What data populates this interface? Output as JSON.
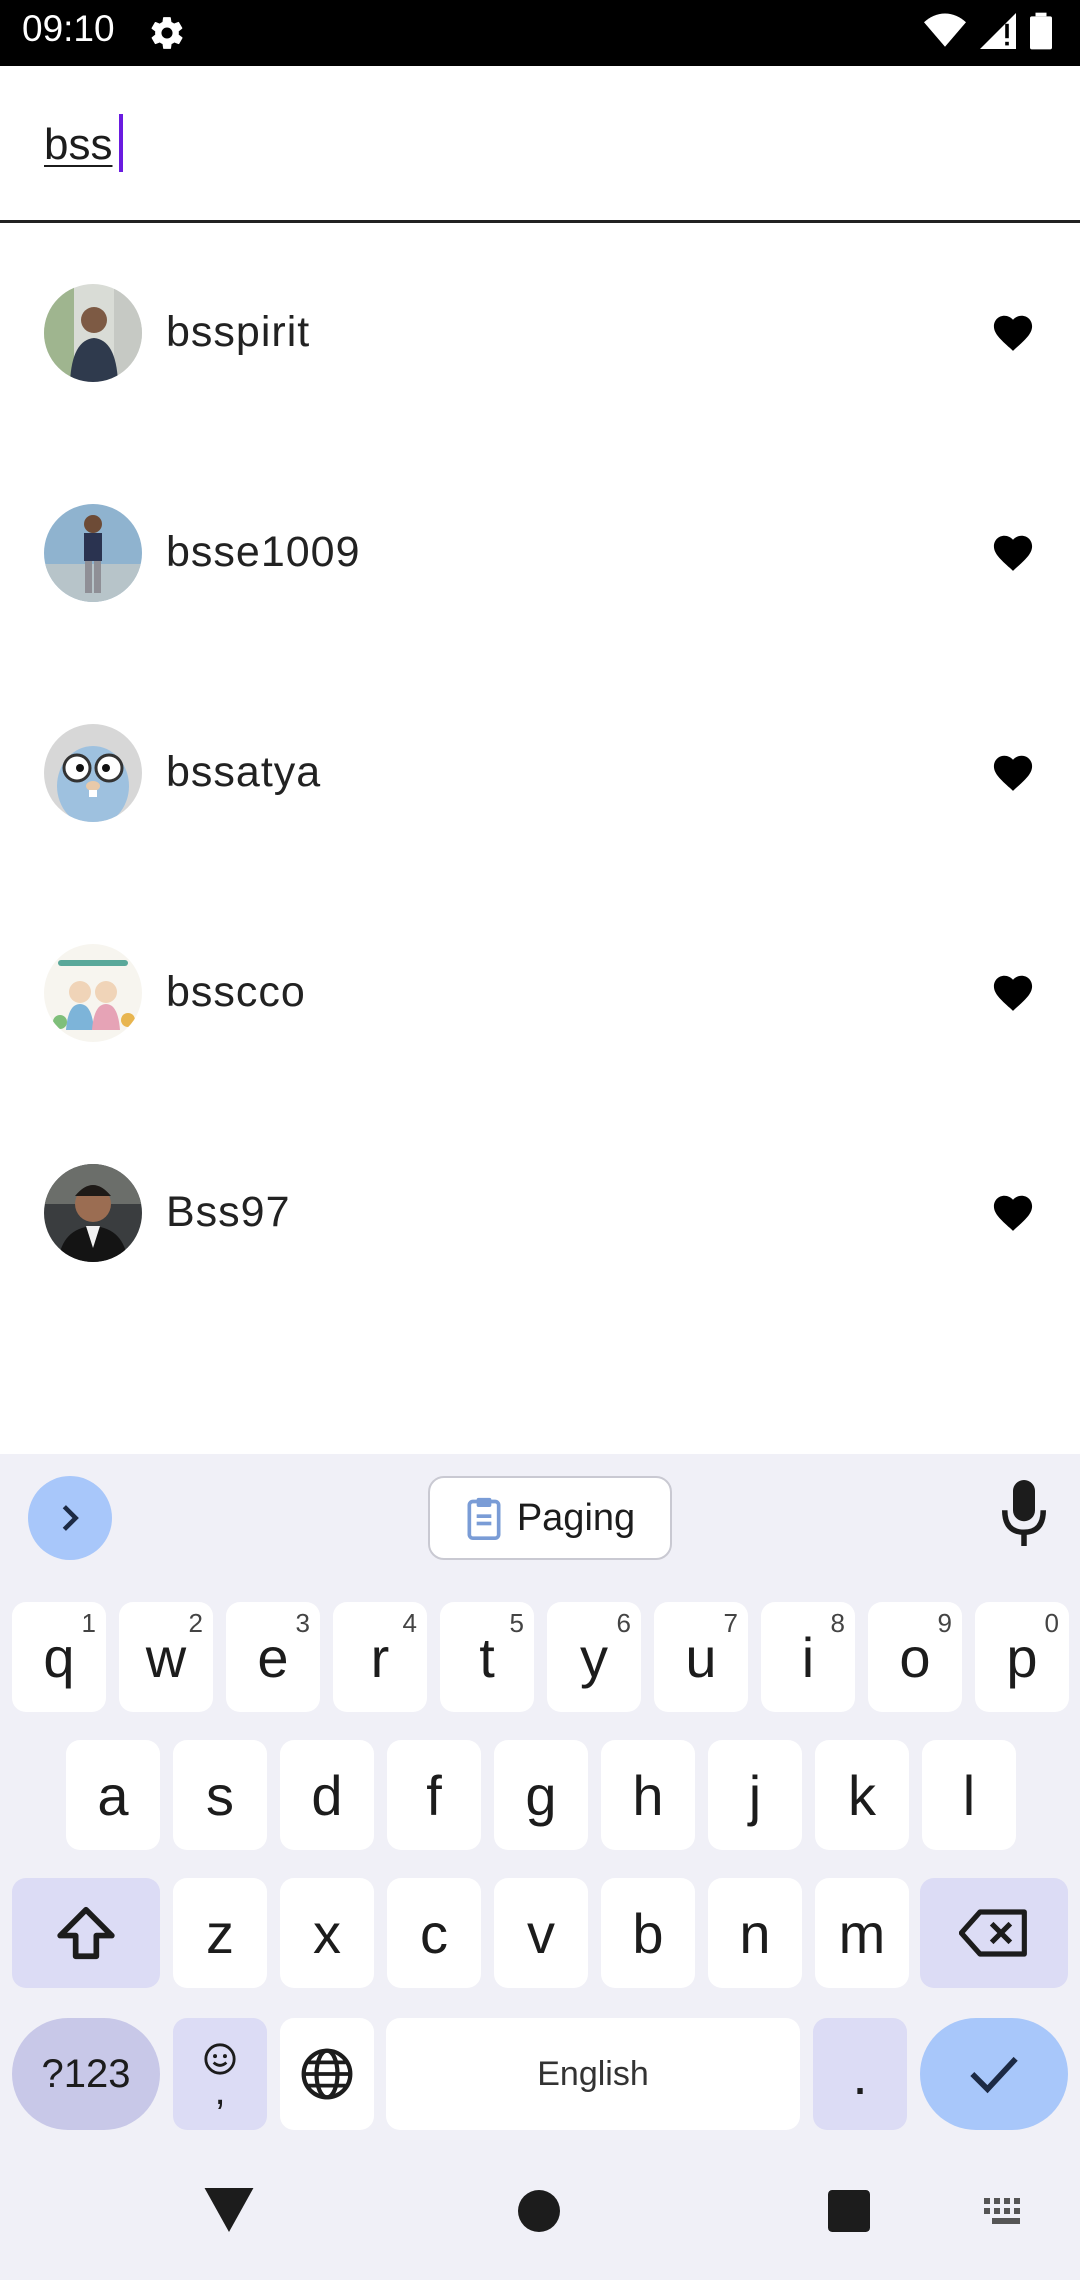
{
  "status_bar": {
    "time": "09:10"
  },
  "search": {
    "query": "bss"
  },
  "users": [
    {
      "username": "bsspirit"
    },
    {
      "username": "bsse1009"
    },
    {
      "username": "bssatya"
    },
    {
      "username": "bsscco"
    },
    {
      "username": "Bss97"
    }
  ],
  "keyboard": {
    "clipboard_chip": "Paging",
    "row1": [
      {
        "letter": "q",
        "num": "1"
      },
      {
        "letter": "w",
        "num": "2"
      },
      {
        "letter": "e",
        "num": "3"
      },
      {
        "letter": "r",
        "num": "4"
      },
      {
        "letter": "t",
        "num": "5"
      },
      {
        "letter": "y",
        "num": "6"
      },
      {
        "letter": "u",
        "num": "7"
      },
      {
        "letter": "i",
        "num": "8"
      },
      {
        "letter": "o",
        "num": "9"
      },
      {
        "letter": "p",
        "num": "0"
      }
    ],
    "row2": [
      "a",
      "s",
      "d",
      "f",
      "g",
      "h",
      "j",
      "k",
      "l"
    ],
    "row3": [
      "z",
      "x",
      "c",
      "v",
      "b",
      "n",
      "m"
    ],
    "symbols_key": "?123",
    "comma_key": ",",
    "space_key": "English",
    "period_key": "."
  },
  "colors": {
    "accent_caret": "#6a1be0",
    "keyboard_bg": "#f0f0f7",
    "action_key": "#a8c7fa"
  }
}
